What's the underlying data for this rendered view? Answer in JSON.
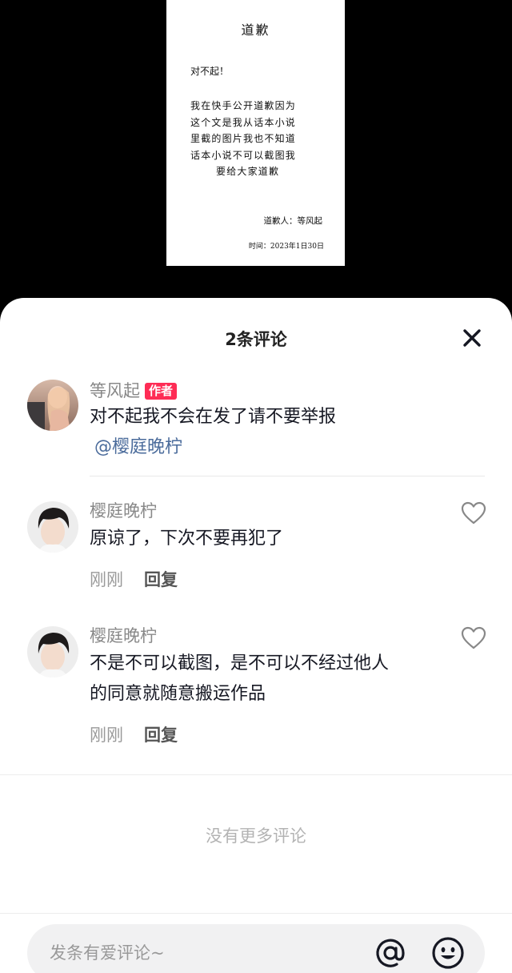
{
  "letter": {
    "title": "道歉",
    "greeting": "对不起！",
    "lines": [
      "我在快手公开道歉因为",
      "这个文是我从话本小说",
      "里截的图片我也不知道",
      "话本小说不可以截图我",
      "要给大家道歉"
    ],
    "signature": "道歉人：等风起",
    "date": "时间：2023年1日30日"
  },
  "sheet": {
    "title": "2条评论"
  },
  "comments": [
    {
      "author": "等风起",
      "badge": "作者",
      "text": "对不起我不会在发了请不要举报",
      "mention": "@樱庭晚柠"
    },
    {
      "author": "樱庭晚柠",
      "text": "原谅了，下次不要再犯了",
      "time": "刚刚",
      "reply": "回复"
    },
    {
      "author": "樱庭晚柠",
      "text_lines": [
        "不是不可以截图，是不可以不经过他人",
        "的同意就随意搬运作品"
      ],
      "time": "刚刚",
      "reply": "回复"
    }
  ],
  "footer": {
    "no_more": "没有更多评论",
    "input_placeholder": "发条有爱评论~"
  },
  "colors": {
    "badge": "#fe2c55",
    "mention": "#4a6b9b"
  },
  "icons": [
    "close-icon",
    "heart-icon",
    "at-icon",
    "emoji-icon"
  ]
}
